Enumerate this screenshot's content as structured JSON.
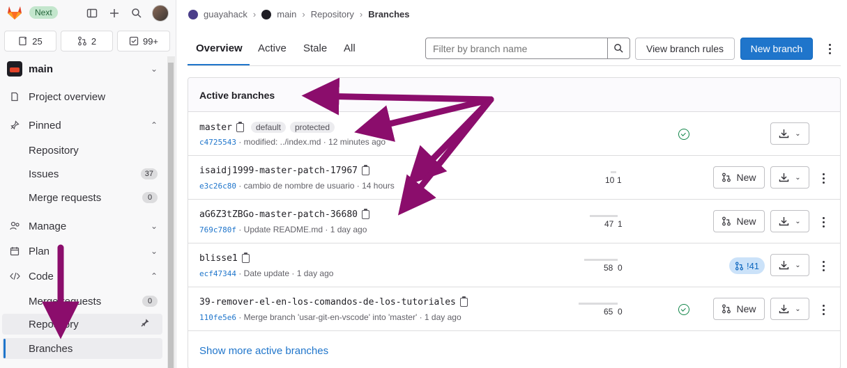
{
  "topbar": {
    "next_label": "Next"
  },
  "counters": {
    "issues": "25",
    "merge_requests": "2",
    "todos": "99+"
  },
  "project": {
    "name": "main"
  },
  "sidebar": {
    "project_overview": "Project overview",
    "pinned": "Pinned",
    "pinned_items": [
      {
        "label": "Repository",
        "count": ""
      },
      {
        "label": "Issues",
        "count": "37"
      },
      {
        "label": "Merge requests",
        "count": "0"
      }
    ],
    "manage": "Manage",
    "plan": "Plan",
    "code": "Code",
    "code_items": [
      {
        "label": "Merge requests",
        "count": "0"
      },
      {
        "label": "Repository",
        "count": ""
      },
      {
        "label": "Branches",
        "count": ""
      }
    ]
  },
  "breadcrumb": [
    "guayahack",
    "main",
    "Repository",
    "Branches"
  ],
  "tabs": [
    "Overview",
    "Active",
    "Stale",
    "All"
  ],
  "filter": {
    "placeholder": "Filter by branch name"
  },
  "buttons": {
    "view_rules": "View branch rules",
    "new_branch": "New branch",
    "new": "New"
  },
  "card": {
    "title": "Active branches",
    "show_more": "Show more active branches"
  },
  "branches": [
    {
      "name": "master",
      "badges": [
        "default",
        "protected"
      ],
      "sha": "c4725543",
      "message": "· modified: ../index.md · 12 minutes ago",
      "behind": "",
      "ahead": "",
      "pipeline": "passed",
      "mr": ""
    },
    {
      "name": "isaidj1999-master-patch-17967",
      "badges": [],
      "sha": "e3c26c80",
      "message": "· cambio de nombre de usuario · 14 hours",
      "behind": "10",
      "ahead": "1",
      "pipeline": "",
      "mr": ""
    },
    {
      "name": "aG6Z3tZBGo-master-patch-36680",
      "badges": [],
      "sha": "769c780f",
      "message": "· Update README.md · 1 day ago",
      "behind": "47",
      "ahead": "1",
      "pipeline": "",
      "mr": ""
    },
    {
      "name": "blisse1",
      "badges": [],
      "sha": "ecf47344",
      "message": "· Date update · 1 day ago",
      "behind": "58",
      "ahead": "0",
      "pipeline": "",
      "mr": "!41"
    },
    {
      "name": "39-remover-el-en-los-comandos-de-los-tutoriales",
      "badges": [],
      "sha": "110fe5e6",
      "message": "· Merge branch 'usar-git-en-vscode' into 'master' · 1 day ago",
      "behind": "65",
      "ahead": "0",
      "pipeline": "passed",
      "mr": ""
    }
  ],
  "colors": {
    "accent": "#1f75cb",
    "annotation_arrow": "#8b0d6c",
    "success": "#108548"
  }
}
